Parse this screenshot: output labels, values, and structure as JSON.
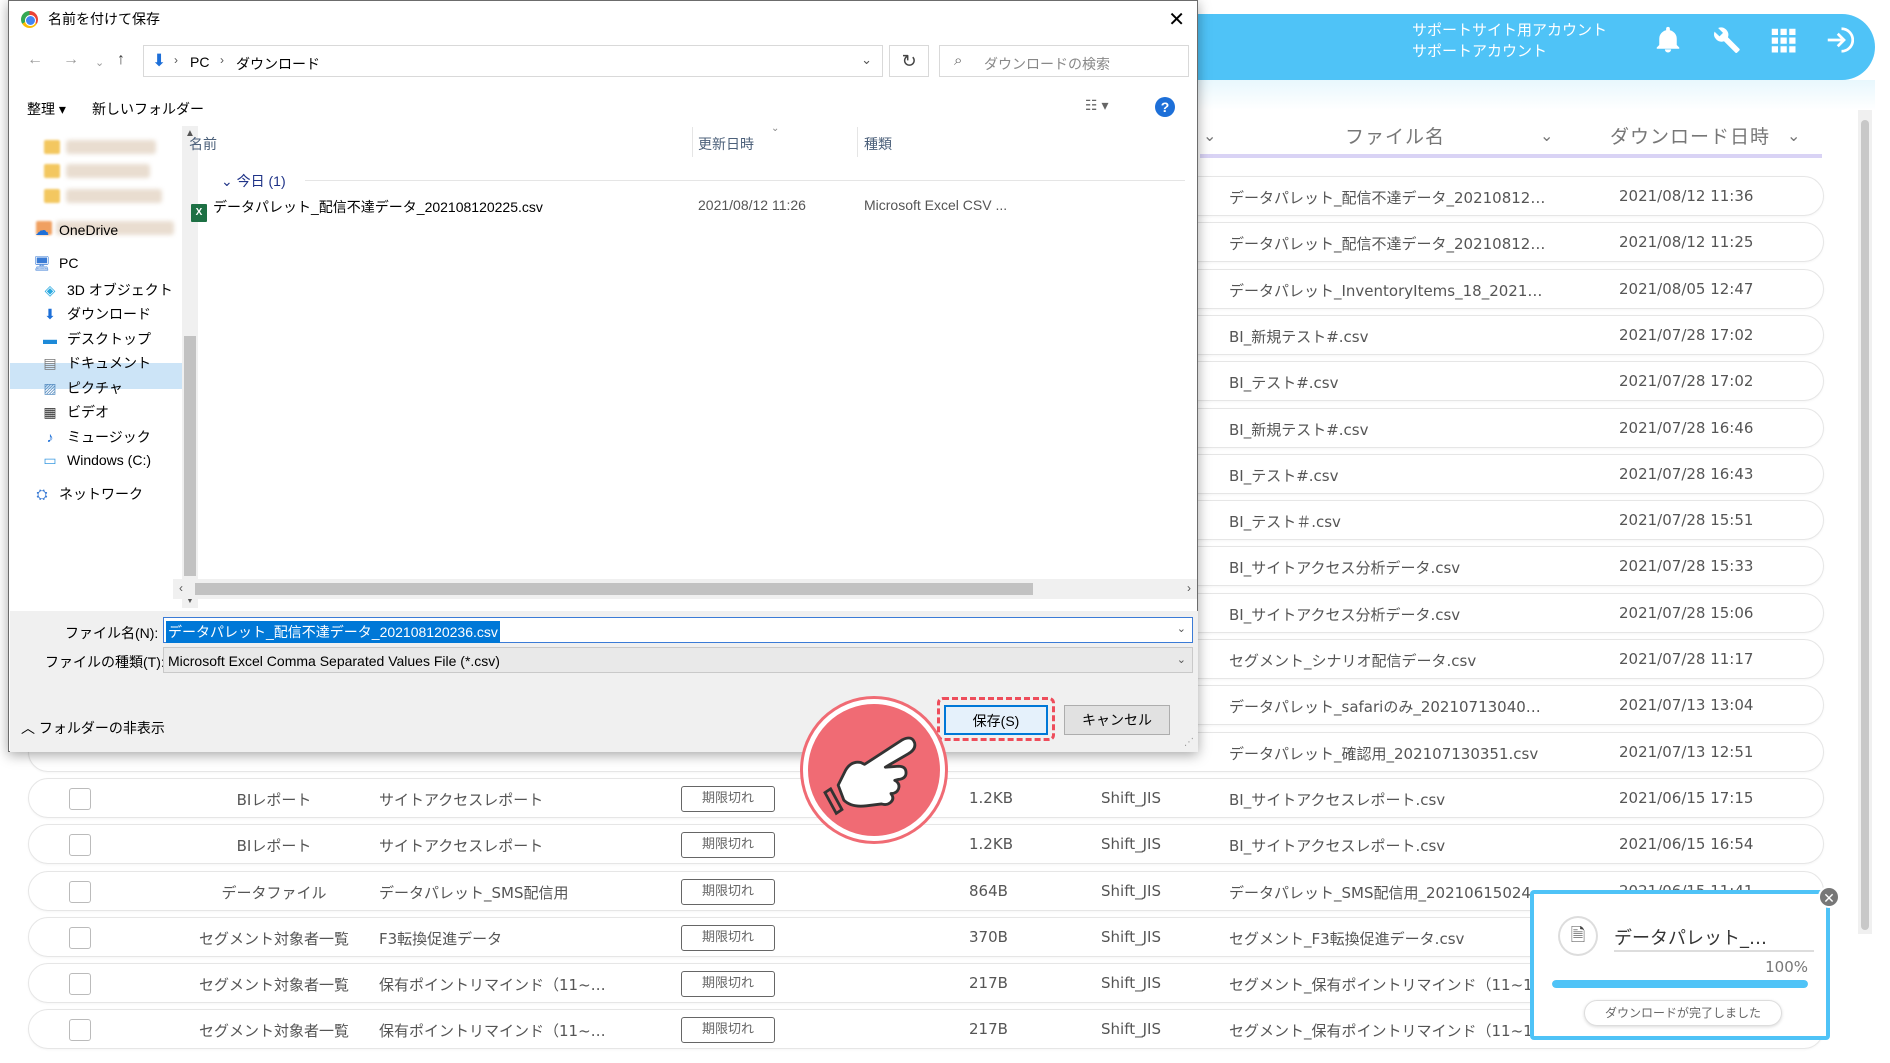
{
  "app": {
    "account_line1": "サポートサイト用アカウント",
    "account_line2": "サポートアカウント",
    "columns": {
      "filename": "ファイル名",
      "download_date": "ダウンロード日時"
    },
    "rows_partial": [
      {
        "file": "データパレット_配信不達データ_20210812…",
        "date": "2021/08/12 11:36"
      },
      {
        "file": "データパレット_配信不達データ_20210812…",
        "date": "2021/08/12 11:25"
      },
      {
        "file": "データパレット_InventoryItems_18_20210…",
        "date": "2021/08/05 12:47"
      },
      {
        "file": "BI_新規テスト#.csv",
        "date": "2021/07/28 17:02"
      },
      {
        "file": "BI_テスト#.csv",
        "date": "2021/07/28 17:02"
      },
      {
        "file": "BI_新規テスト#.csv",
        "date": "2021/07/28 16:46"
      },
      {
        "file": "BI_テスト#.csv",
        "date": "2021/07/28 16:43"
      },
      {
        "file": "BI_テスト＃.csv",
        "date": "2021/07/28 15:51"
      },
      {
        "file": "BI_サイトアクセス分析データ.csv",
        "date": "2021/07/28 15:33"
      },
      {
        "file": "BI_サイトアクセス分析データ.csv",
        "date": "2021/07/28 15:06"
      },
      {
        "file": "セグメント_シナリオ配信データ.csv",
        "date": "2021/07/28 11:17"
      },
      {
        "file": "データパレット_safariのみ_20210713040…",
        "date": "2021/07/13 13:04"
      },
      {
        "file": "データパレット_確認用_202107130351.csv",
        "date": "2021/07/13 12:51"
      }
    ],
    "rows_full": [
      {
        "type": "BIレポート",
        "name": "サイトアクセスレポート",
        "status": "期限切れ",
        "size": "1.2KB",
        "enc": "Shift_JIS",
        "file": "BI_サイトアクセスレポート.csv",
        "date": "2021/06/15 17:15"
      },
      {
        "type": "BIレポート",
        "name": "サイトアクセスレポート",
        "status": "期限切れ",
        "size": "1.2KB",
        "enc": "Shift_JIS",
        "file": "BI_サイトアクセスレポート.csv",
        "date": "2021/06/15 16:54"
      },
      {
        "type": "データファイル",
        "name": "データパレット_SMS配信用",
        "status": "期限切れ",
        "size": "864B",
        "enc": "Shift_JIS",
        "file": "データパレット_SMS配信用_20210615024…",
        "date": "2021/06/15 11:41"
      },
      {
        "type": "セグメント対象者一覧",
        "name": "F3転換促進データ",
        "status": "期限切れ",
        "size": "370B",
        "enc": "Shift_JIS",
        "file": "セグメント_F3転換促進データ.csv",
        "date": ""
      },
      {
        "type": "セグメント対象者一覧",
        "name": "保有ポイントリマインド（11~…",
        "status": "期限切れ",
        "size": "217B",
        "enc": "Shift_JIS",
        "file": "セグメント_保有ポイントリマインド（11~1…",
        "date": ""
      },
      {
        "type": "セグメント対象者一覧",
        "name": "保有ポイントリマインド（11~…",
        "status": "期限切れ",
        "size": "217B",
        "enc": "Shift_JIS",
        "file": "セグメント_保有ポイントリマインド（11~1…",
        "date": ""
      }
    ],
    "accent_color": "#4fc3f7"
  },
  "dialog": {
    "title": "名前を付けて保存",
    "breadcrumb": [
      "PC",
      "ダウンロード"
    ],
    "search_placeholder": "ダウンロードの検索",
    "toolbar": {
      "organize": "整理 ▾",
      "new_folder": "新しいフォルダー"
    },
    "nav": {
      "onedrive": "OneDrive",
      "pc": "PC",
      "objects3d": "3D オブジェクト",
      "downloads": "ダウンロード",
      "desktop": "デスクトップ",
      "documents": "ドキュメント",
      "pictures": "ピクチャ",
      "videos": "ビデオ",
      "music": "ミュージック",
      "windows_c": "Windows (C:)",
      "network": "ネットワーク"
    },
    "list_headers": {
      "name": "名前",
      "modified": "更新日時",
      "type": "種類"
    },
    "group_label": "今日 (1)",
    "file": {
      "name": "データパレット_配信不達データ_202108120225.csv",
      "modified": "2021/08/12 11:26",
      "type": "Microsoft Excel CSV ..."
    },
    "filename_label": "ファイル名(N):",
    "filename_value": "データパレット_配信不達データ_202108120236.csv",
    "filetype_label": "ファイルの種類(T):",
    "filetype_value": "Microsoft Excel Comma Separated Values File (*.csv)",
    "hide_folders": "フォルダーの非表示",
    "save_button": "保存(S)",
    "cancel_button": "キャンセル"
  },
  "toast": {
    "filename": "データパレット_配信不達データ",
    "percent": "100%",
    "progress": 1.0,
    "status": "ダウンロードが完了しました"
  }
}
